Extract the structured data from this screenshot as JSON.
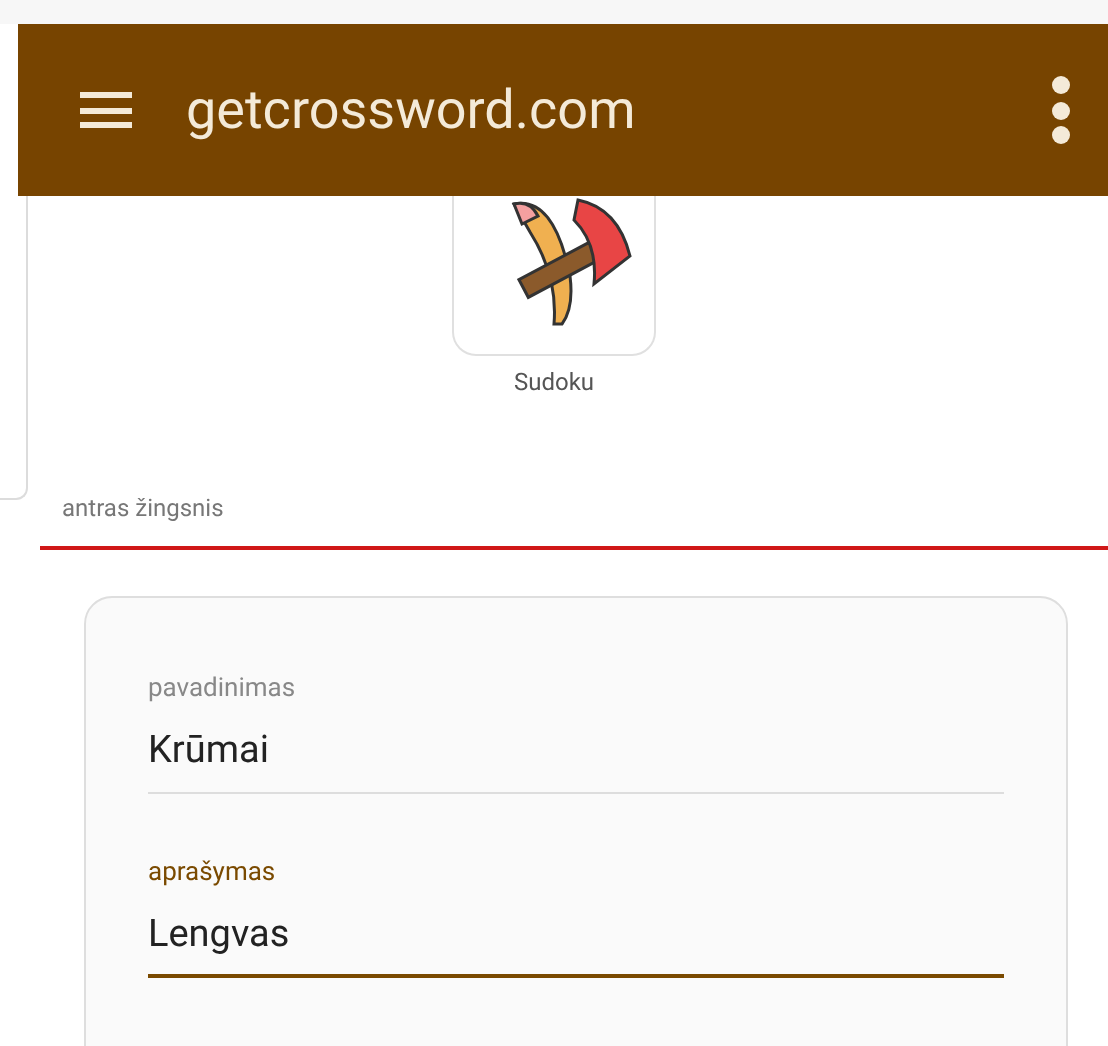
{
  "app_bar": {
    "title": "getcrossword.com"
  },
  "game": {
    "label": "Sudoku"
  },
  "step": {
    "label": "antras žingsnis"
  },
  "fields": [
    {
      "label": "pavadinimas",
      "value": "Krūmai",
      "focused": false
    },
    {
      "label": "aprašymas",
      "value": "Lengvas",
      "focused": true
    }
  ]
}
